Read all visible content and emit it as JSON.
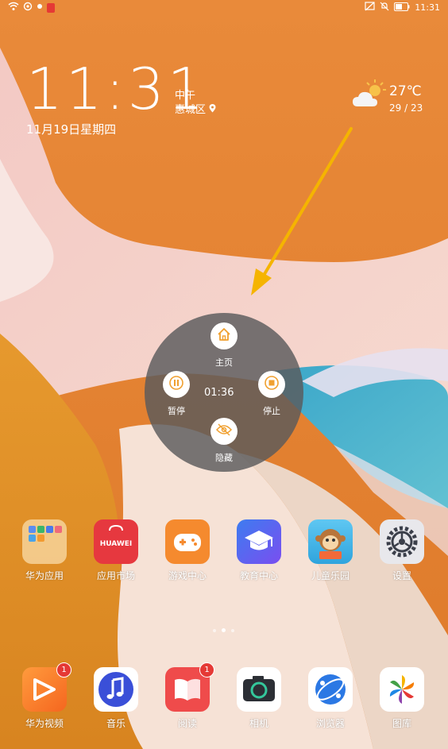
{
  "status_bar": {
    "time": "11:31"
  },
  "lock": {
    "time": "11:31",
    "period": "中午",
    "location": "惠城区",
    "date": "11月19日星期四"
  },
  "weather": {
    "temp": "27℃",
    "range": "29 / 23",
    "icon": "partly-cloudy-icon"
  },
  "float_dial": {
    "home_label": "主页",
    "pause_label": "暂停",
    "stop_label": "停止",
    "hide_label": "隐藏",
    "timer": "01:36"
  },
  "apps_row1": [
    {
      "label": "华为应用",
      "icon": "folder-icon"
    },
    {
      "label": "应用市场",
      "icon": "huawei-appgallery-icon",
      "brand_text": "HUAWEI"
    },
    {
      "label": "游戏中心",
      "icon": "gamepad-icon"
    },
    {
      "label": "教育中心",
      "icon": "graduation-cap-icon"
    },
    {
      "label": "儿童乐园",
      "icon": "monkey-icon"
    },
    {
      "label": "设置",
      "icon": "gear-icon"
    }
  ],
  "dock": [
    {
      "label": "华为视频",
      "icon": "video-play-icon",
      "badge": "1"
    },
    {
      "label": "音乐",
      "icon": "music-note-icon"
    },
    {
      "label": "阅读",
      "icon": "book-icon",
      "badge": "1"
    },
    {
      "label": "相机",
      "icon": "camera-icon"
    },
    {
      "label": "浏览器",
      "icon": "globe-icon"
    },
    {
      "label": "图库",
      "icon": "pinwheel-icon"
    }
  ],
  "colors": {
    "arrow": "#f5b400",
    "dial_icon": "#f0a030"
  }
}
